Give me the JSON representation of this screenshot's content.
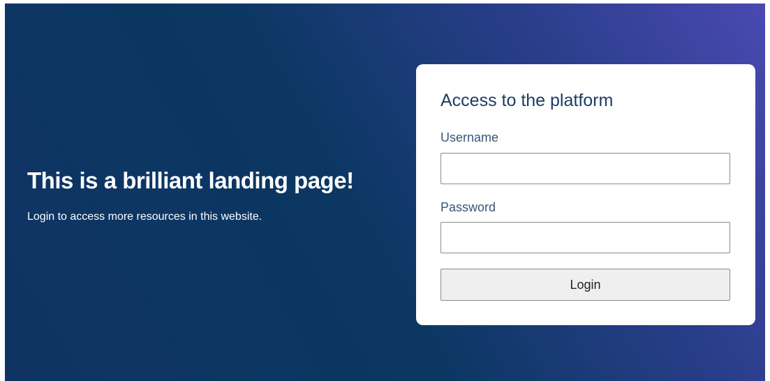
{
  "hero": {
    "title": "This is a brilliant landing page!",
    "subtitle": "Login to access more resources in this website."
  },
  "login_form": {
    "title": "Access to the platform",
    "username": {
      "label": "Username",
      "value": "",
      "placeholder": ""
    },
    "password": {
      "label": "Password",
      "value": "",
      "placeholder": ""
    },
    "submit_label": "Login"
  },
  "colors": {
    "background_gradient_start": "#0f3464",
    "background_gradient_end": "#4a49b1",
    "card_background": "#ffffff",
    "heading_text": "#1d3c63",
    "label_text": "#3a5578",
    "button_background": "#efefef"
  }
}
